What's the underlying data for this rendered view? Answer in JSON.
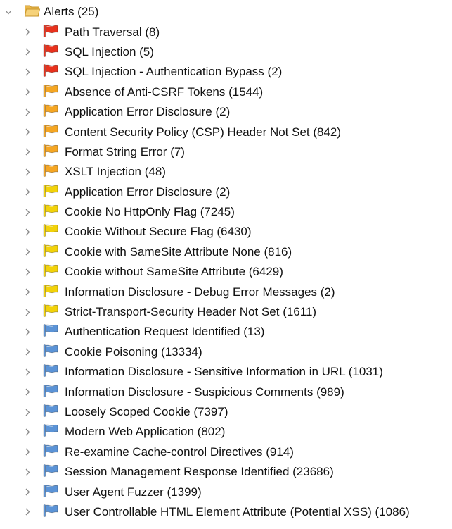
{
  "tree": {
    "root": {
      "label": "Alerts (25)",
      "expanded": true,
      "icon": "folder-open-icon"
    },
    "colors": {
      "high": "#e8321d",
      "medium": "#f5a623",
      "low": "#f2d20a",
      "informational": "#5b93d6",
      "chevron": "#8a8a8a",
      "folder": "#f3c45c"
    },
    "items": [
      {
        "label": "Path Traversal (8)",
        "risk": "high",
        "icon": "red-flag-icon"
      },
      {
        "label": "SQL Injection (5)",
        "risk": "high",
        "icon": "red-flag-icon"
      },
      {
        "label": "SQL Injection - Authentication Bypass (2)",
        "risk": "high",
        "icon": "red-flag-icon"
      },
      {
        "label": "Absence of Anti-CSRF Tokens (1544)",
        "risk": "medium",
        "icon": "orange-flag-icon"
      },
      {
        "label": "Application Error Disclosure (2)",
        "risk": "medium",
        "icon": "orange-flag-icon"
      },
      {
        "label": "Content Security Policy (CSP) Header Not Set (842)",
        "risk": "medium",
        "icon": "orange-flag-icon"
      },
      {
        "label": "Format String Error (7)",
        "risk": "medium",
        "icon": "orange-flag-icon"
      },
      {
        "label": "XSLT Injection (48)",
        "risk": "medium",
        "icon": "orange-flag-icon"
      },
      {
        "label": "Application Error Disclosure (2)",
        "risk": "low",
        "icon": "yellow-flag-icon"
      },
      {
        "label": "Cookie No HttpOnly Flag (7245)",
        "risk": "low",
        "icon": "yellow-flag-icon"
      },
      {
        "label": "Cookie Without Secure Flag (6430)",
        "risk": "low",
        "icon": "yellow-flag-icon"
      },
      {
        "label": "Cookie with SameSite Attribute None (816)",
        "risk": "low",
        "icon": "yellow-flag-icon"
      },
      {
        "label": "Cookie without SameSite Attribute (6429)",
        "risk": "low",
        "icon": "yellow-flag-icon"
      },
      {
        "label": "Information Disclosure - Debug Error Messages (2)",
        "risk": "low",
        "icon": "yellow-flag-icon"
      },
      {
        "label": "Strict-Transport-Security Header Not Set (1611)",
        "risk": "low",
        "icon": "yellow-flag-icon"
      },
      {
        "label": "Authentication Request Identified (13)",
        "risk": "informational",
        "icon": "blue-flag-icon"
      },
      {
        "label": "Cookie Poisoning (13334)",
        "risk": "informational",
        "icon": "blue-flag-icon"
      },
      {
        "label": "Information Disclosure - Sensitive Information in URL (1031)",
        "risk": "informational",
        "icon": "blue-flag-icon"
      },
      {
        "label": "Information Disclosure - Suspicious Comments (989)",
        "risk": "informational",
        "icon": "blue-flag-icon"
      },
      {
        "label": "Loosely Scoped Cookie (7397)",
        "risk": "informational",
        "icon": "blue-flag-icon"
      },
      {
        "label": "Modern Web Application (802)",
        "risk": "informational",
        "icon": "blue-flag-icon"
      },
      {
        "label": "Re-examine Cache-control Directives (914)",
        "risk": "informational",
        "icon": "blue-flag-icon"
      },
      {
        "label": "Session Management Response Identified (23686)",
        "risk": "informational",
        "icon": "blue-flag-icon"
      },
      {
        "label": "User Agent Fuzzer (1399)",
        "risk": "informational",
        "icon": "blue-flag-icon"
      },
      {
        "label": "User Controllable HTML Element Attribute (Potential XSS) (1086)",
        "risk": "informational",
        "icon": "blue-flag-icon"
      }
    ]
  }
}
